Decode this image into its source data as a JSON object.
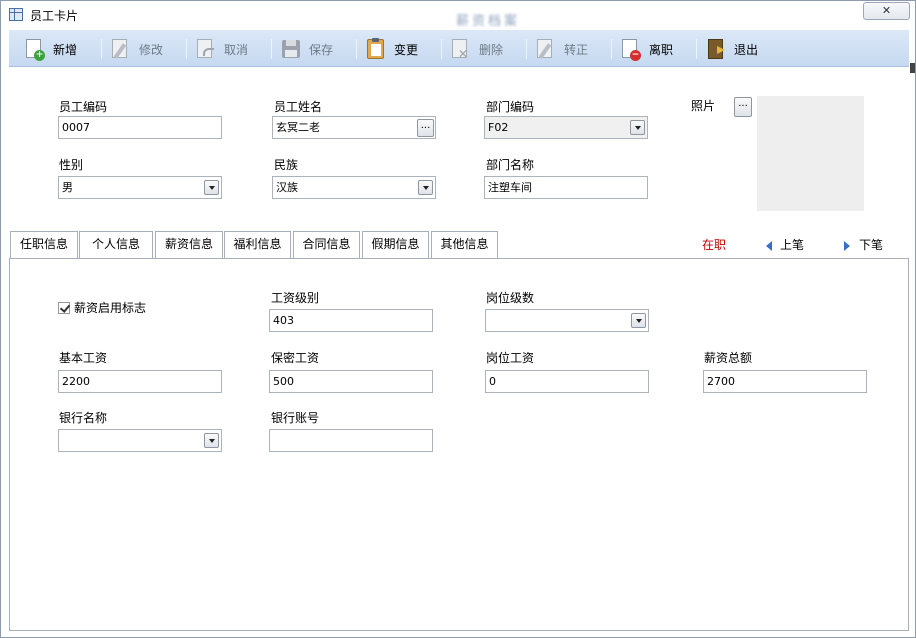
{
  "window": {
    "title": "员工卡片",
    "center_title": "薪资档案",
    "close_label": "✕"
  },
  "toolbar": {
    "buttons": [
      {
        "key": "new",
        "label": "新增",
        "icon": "new-doc-icon",
        "enabled": true
      },
      {
        "key": "edit",
        "label": "修改",
        "icon": "edit-icon",
        "enabled": false
      },
      {
        "key": "cancel",
        "label": "取消",
        "icon": "undo-icon",
        "enabled": false
      },
      {
        "key": "save",
        "label": "保存",
        "icon": "save-icon",
        "enabled": false
      },
      {
        "key": "change",
        "label": "变更",
        "icon": "clipboard-icon",
        "enabled": true
      },
      {
        "key": "delete",
        "label": "删除",
        "icon": "delete-icon",
        "enabled": false
      },
      {
        "key": "regularize",
        "label": "转正",
        "icon": "regularize-icon",
        "enabled": false
      },
      {
        "key": "resign",
        "label": "离职",
        "icon": "resign-icon",
        "enabled": true
      },
      {
        "key": "exit",
        "label": "退出",
        "icon": "exit-door-icon",
        "enabled": true
      }
    ]
  },
  "header_form": {
    "employee_code": {
      "label": "员工编码",
      "value": "0007"
    },
    "employee_name": {
      "label": "员工姓名",
      "value": "玄冥二老",
      "button": "..."
    },
    "dept_code": {
      "label": "部门编码",
      "value": "F02"
    },
    "gender": {
      "label": "性别",
      "value": "男"
    },
    "ethnicity": {
      "label": "民族",
      "value": "汉族"
    },
    "dept_name": {
      "label": "部门名称",
      "value": "注塑车间"
    },
    "photo": {
      "label": "照片",
      "button": "..."
    }
  },
  "tabs": [
    {
      "label": "任职信息",
      "active": false
    },
    {
      "label": "个人信息",
      "active": false
    },
    {
      "label": "薪资信息",
      "active": true
    },
    {
      "label": "福利信息",
      "active": false
    },
    {
      "label": "合同信息",
      "active": false
    },
    {
      "label": "假期信息",
      "active": false
    },
    {
      "label": "其他信息",
      "active": false
    }
  ],
  "status": {
    "employment": "在职",
    "status_color": "#c00000",
    "prev_label": "上笔",
    "next_label": "下笔"
  },
  "salary": {
    "enabled_flag": {
      "label": "薪资启用标志",
      "checked": true
    },
    "salary_grade": {
      "label": "工资级别",
      "value": "403"
    },
    "position_level": {
      "label": "岗位级数",
      "value": ""
    },
    "base_salary": {
      "label": "基本工资",
      "value": "2200"
    },
    "confidential_salary": {
      "label": "保密工资",
      "value": "500"
    },
    "position_salary": {
      "label": "岗位工资",
      "value": "0"
    },
    "total_salary": {
      "label": "薪资总额",
      "value": "2700"
    },
    "bank_name": {
      "label": "银行名称",
      "value": ""
    },
    "bank_account": {
      "label": "银行账号",
      "value": ""
    }
  }
}
